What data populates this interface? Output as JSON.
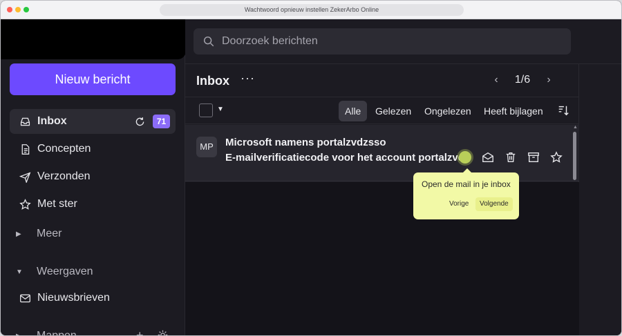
{
  "browser": {
    "title": "Wachtwoord opnieuw instellen ZekerArbo Online"
  },
  "sidebar": {
    "compose_label": "Nieuw bericht",
    "items": [
      {
        "label": "Inbox",
        "icon": "inbox-icon",
        "count": "71"
      },
      {
        "label": "Concepten",
        "icon": "drafts-icon"
      },
      {
        "label": "Verzonden",
        "icon": "sent-icon"
      },
      {
        "label": "Met ster",
        "icon": "star-icon"
      }
    ],
    "more_label": "Meer",
    "views_label": "Weergaven",
    "newsletters_label": "Nieuwsbrieven",
    "folders_label": "Mappen"
  },
  "search": {
    "placeholder": "Doorzoek berichten"
  },
  "list": {
    "title": "Inbox",
    "more": "···",
    "pagination": "1/6",
    "filters": [
      "Alle",
      "Gelezen",
      "Ongelezen",
      "Heeft bijlagen"
    ],
    "active_filter": "Alle"
  },
  "messages": [
    {
      "avatar": "MP",
      "sender": "Microsoft namens portalzvdzsso",
      "subject": "E-mailverificatiecode voor het account portalzvdzsso"
    }
  ],
  "tooltip": {
    "text": "Open de mail in je inbox",
    "prev": "Vorige",
    "next": "Volgende"
  },
  "colors": {
    "accent": "#6d4aff",
    "badge": "#8b6cf7",
    "tooltip": "#f2f9a6",
    "highlight_dot": "#b9cf59"
  }
}
